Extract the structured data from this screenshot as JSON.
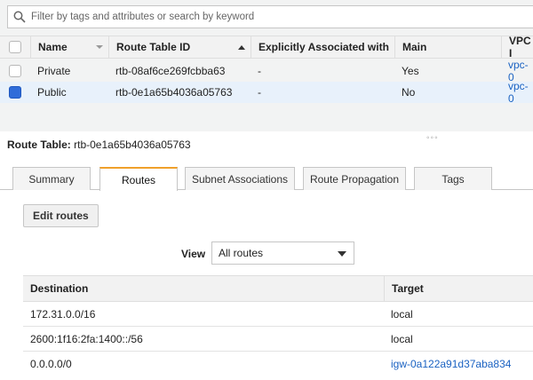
{
  "search": {
    "placeholder": "Filter by tags and attributes or search by keyword"
  },
  "grid": {
    "columns": [
      "Name",
      "Route Table ID",
      "Explicitly Associated with",
      "Main",
      "VPC I"
    ],
    "rows": [
      {
        "name": "Private",
        "route_table_id": "rtb-08af6ce269fcbba63",
        "explicit": "-",
        "main": "Yes",
        "vpc": "vpc-0",
        "selected": false
      },
      {
        "name": "Public",
        "route_table_id": "rtb-0e1a65b4036a05763",
        "explicit": "-",
        "main": "No",
        "vpc": "vpc-0",
        "selected": true
      }
    ]
  },
  "detail": {
    "title_label": "Route Table:",
    "title_value": "rtb-0e1a65b4036a05763",
    "tabs": [
      "Summary",
      "Routes",
      "Subnet Associations",
      "Route Propagation",
      "Tags"
    ],
    "active_tab": "Routes",
    "edit_button": "Edit routes",
    "view_label": "View",
    "view_value": "All routes",
    "routes_columns": [
      "Destination",
      "Target"
    ],
    "routes": [
      {
        "destination": "172.31.0.0/16",
        "target": "local"
      },
      {
        "destination": "2600:1f16:2fa:1400::/56",
        "target": "local"
      },
      {
        "destination": "0.0.0.0/0",
        "target": "igw-0a122a91d37aba834"
      }
    ]
  },
  "colors": {
    "accent_tab": "#f0a02b",
    "link": "#1a62c2",
    "selected_row": "#e8f1fb",
    "checkbox_on": "#2f6cd9"
  }
}
